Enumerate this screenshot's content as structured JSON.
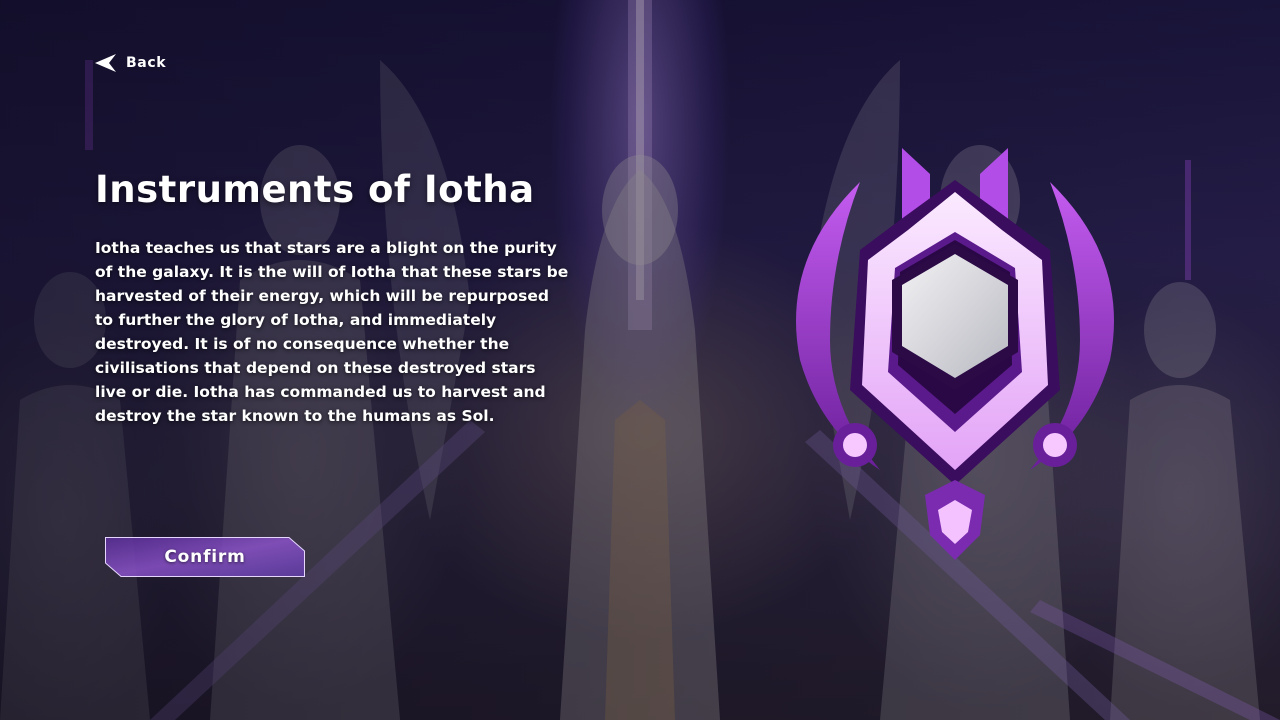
{
  "nav": {
    "back_label": "Back"
  },
  "faction": {
    "title": "Instruments of Iotha",
    "description_lines": [
      "Iotha teaches us that stars are a blight on the purity",
      "of the galaxy. It is the will of Iotha that these stars be",
      "harvested of their energy, which will be repurposed",
      "to further the glory of Iotha, and immediately",
      "destroyed. It is of no consequence whether the",
      "civilisations that depend on these destroyed stars",
      "live or die. Iotha has commanded us to harvest and",
      "destroy the star known to the humans as Sol."
    ],
    "emblem_icon": "hexagon-crest-emblem-icon"
  },
  "actions": {
    "confirm_label": "Confirm"
  },
  "colors": {
    "accent_purple": "#b04de6",
    "emblem_light": "#f4d6ff",
    "text": "#ffffff",
    "button_fill": "#6a3aa8"
  }
}
